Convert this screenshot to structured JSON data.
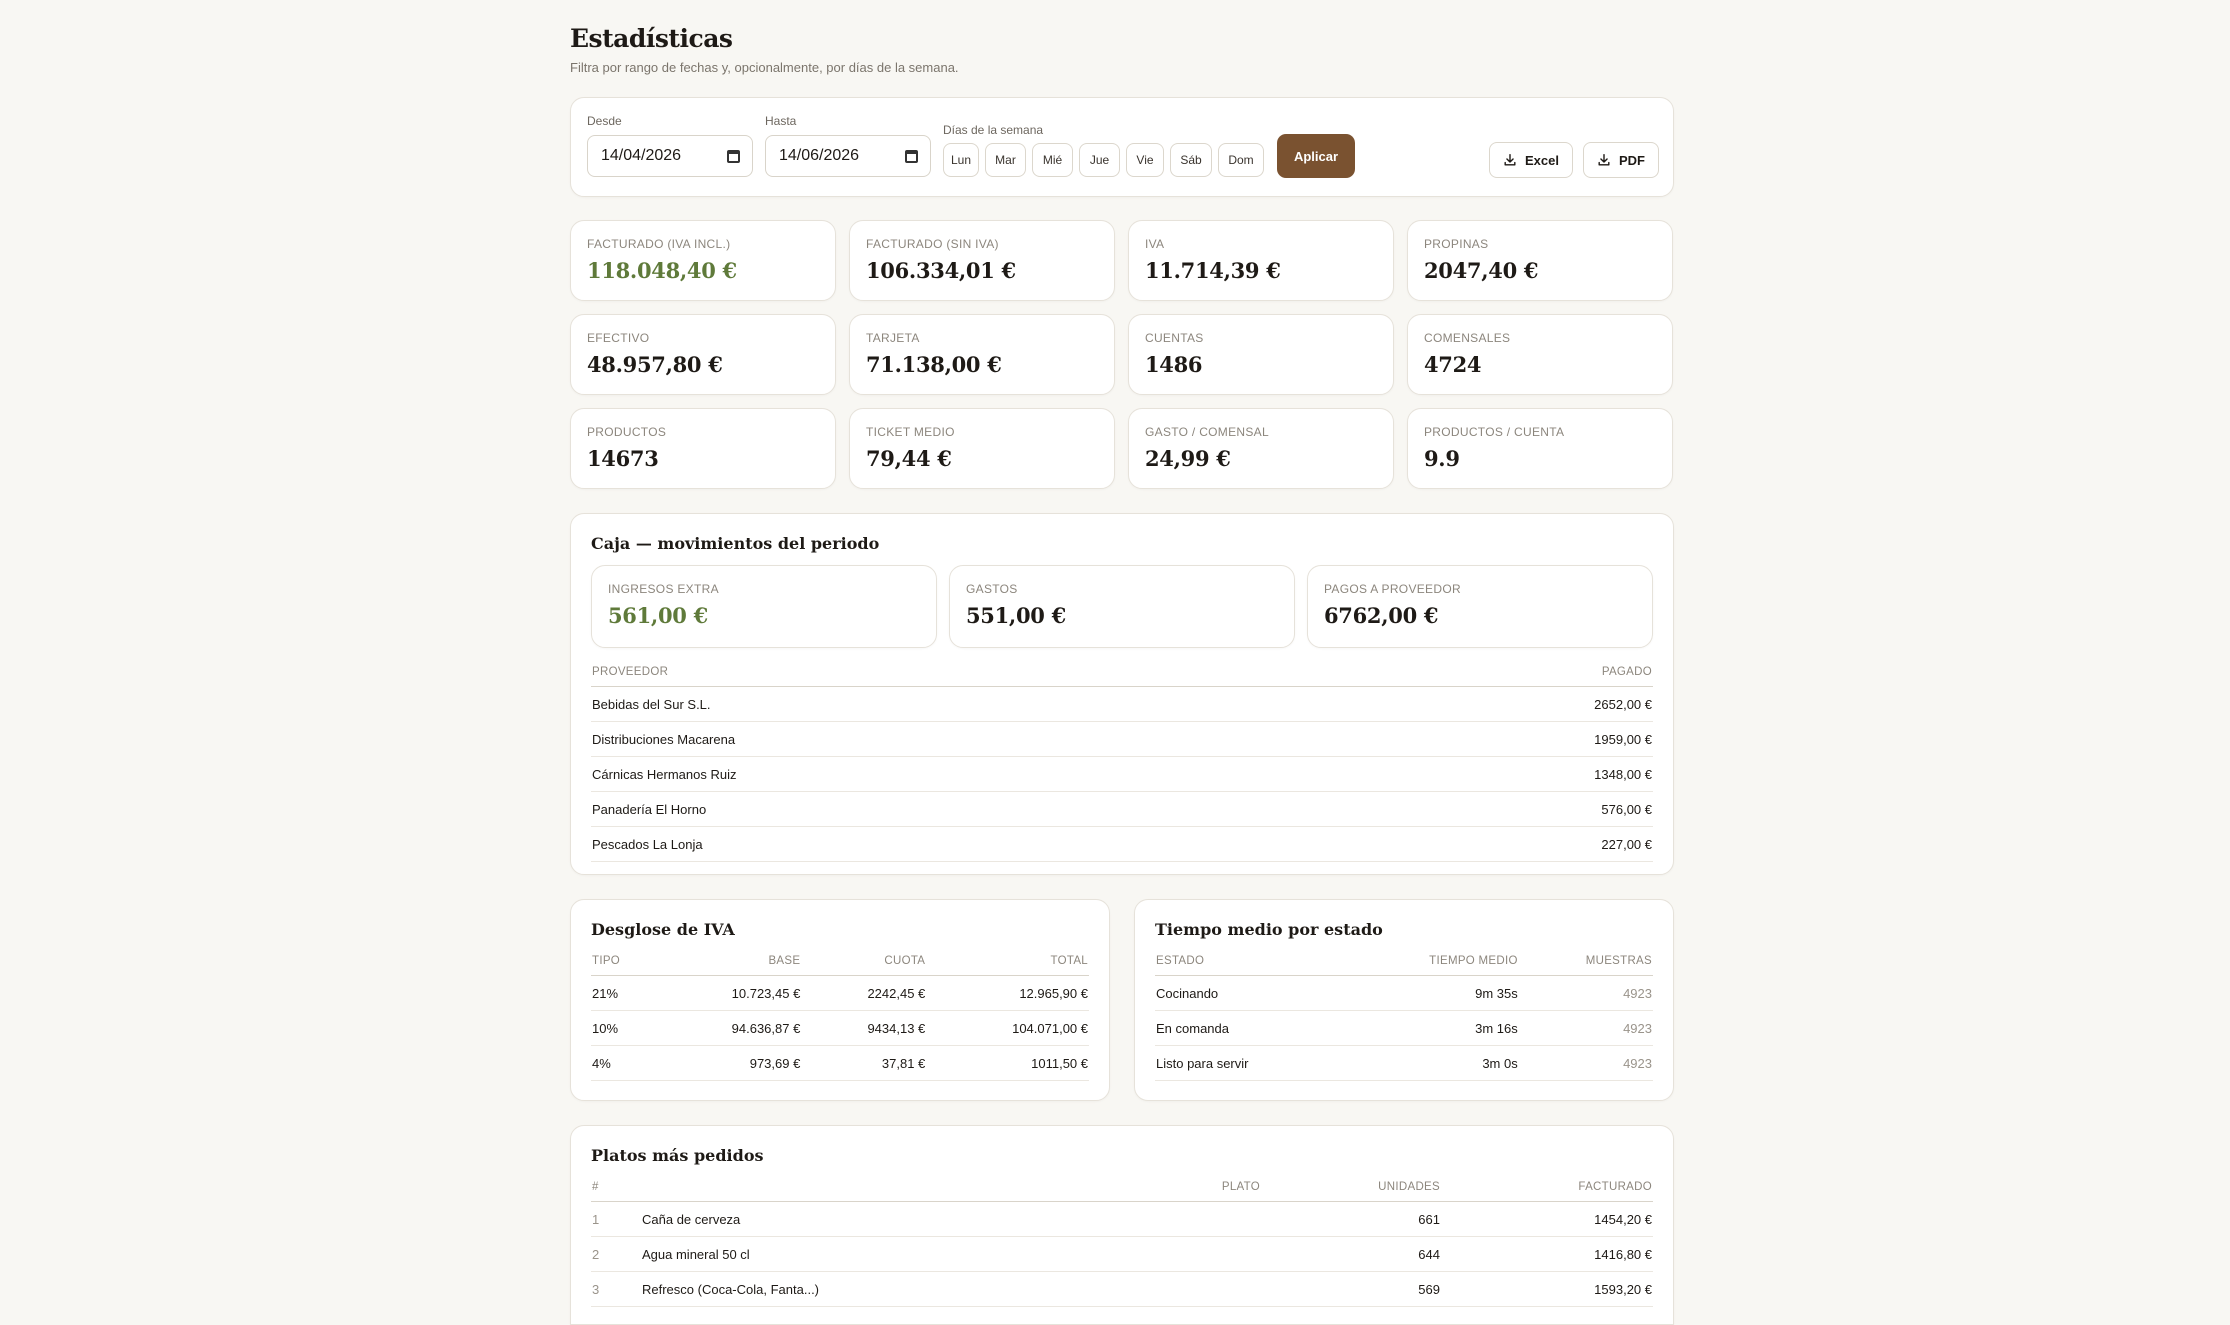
{
  "header": {
    "title": "Estadísticas",
    "subtitle": "Filtra por rango de fechas y, opcionalmente, por días de la semana."
  },
  "filters": {
    "from_label": "Desde",
    "from_value": "14/04/2026",
    "to_label": "Hasta",
    "to_value": "14/06/2026",
    "days_label": "Días de la semana",
    "days": [
      "Lun",
      "Mar",
      "Mié",
      "Jue",
      "Vie",
      "Sáb",
      "Dom"
    ],
    "apply_label": "Aplicar",
    "excel_label": "Excel",
    "pdf_label": "PDF"
  },
  "kpis": [
    {
      "label": "FACTURADO (IVA INCL.)",
      "value": "118.048,40 €",
      "accent": true
    },
    {
      "label": "FACTURADO (SIN IVA)",
      "value": "106.334,01 €"
    },
    {
      "label": "IVA",
      "value": "11.714,39 €"
    },
    {
      "label": "PROPINAS",
      "value": "2047,40 €"
    },
    {
      "label": "EFECTIVO",
      "value": "48.957,80 €"
    },
    {
      "label": "TARJETA",
      "value": "71.138,00 €"
    },
    {
      "label": "CUENTAS",
      "value": "1486"
    },
    {
      "label": "COMENSALES",
      "value": "4724"
    },
    {
      "label": "PRODUCTOS",
      "value": "14673"
    },
    {
      "label": "TICKET MEDIO",
      "value": "79,44 €"
    },
    {
      "label": "GASTO / COMENSAL",
      "value": "24,99 €"
    },
    {
      "label": "PRODUCTOS / CUENTA",
      "value": "9.9"
    }
  ],
  "caja": {
    "title": "Caja — movimientos del periodo",
    "kpis": [
      {
        "label": "INGRESOS EXTRA",
        "value": "561,00 €",
        "accent": true
      },
      {
        "label": "GASTOS",
        "value": "551,00 €"
      },
      {
        "label": "PAGOS A PROVEEDOR",
        "value": "6762,00 €"
      }
    ],
    "table_headers": [
      "PROVEEDOR",
      "PAGADO"
    ],
    "rows": [
      [
        "Bebidas del Sur S.L.",
        "2652,00 €"
      ],
      [
        "Distribuciones Macarena",
        "1959,00 €"
      ],
      [
        "Cárnicas Hermanos Ruiz",
        "1348,00 €"
      ],
      [
        "Panadería El Horno",
        "576,00 €"
      ],
      [
        "Pescados La Lonja",
        "227,00 €"
      ]
    ]
  },
  "iva": {
    "title": "Desglose de IVA",
    "headers": [
      "TIPO",
      "BASE",
      "CUOTA",
      "TOTAL"
    ],
    "rows": [
      [
        "21%",
        "10.723,45 €",
        "2242,45 €",
        "12.965,90 €"
      ],
      [
        "10%",
        "94.636,87 €",
        "9434,13 €",
        "104.071,00 €"
      ],
      [
        "4%",
        "973,69 €",
        "37,81 €",
        "1011,50 €"
      ]
    ]
  },
  "tiempos": {
    "title": "Tiempo medio por estado",
    "headers": [
      "ESTADO",
      "TIEMPO MEDIO",
      "MUESTRAS"
    ],
    "rows": [
      [
        "Cocinando",
        "9m 35s",
        "4923"
      ],
      [
        "En comanda",
        "3m 16s",
        "4923"
      ],
      [
        "Listo para servir",
        "3m 0s",
        "4923"
      ]
    ]
  },
  "platos": {
    "title": "Platos más pedidos",
    "headers": [
      "#",
      "PLATO",
      "UNIDADES",
      "FACTURADO"
    ],
    "rows": [
      [
        "1",
        "Caña de cerveza",
        "661",
        "1454,20 €"
      ],
      [
        "2",
        "Agua mineral 50 cl",
        "644",
        "1416,80 €"
      ],
      [
        "3",
        "Refresco (Coca-Cola, Fanta...)",
        "569",
        "1593,20 €"
      ]
    ]
  },
  "colors": {
    "accent_green": "#5f7a3a",
    "apply_brown": "#7a5230",
    "background": "#f8f7f3"
  }
}
